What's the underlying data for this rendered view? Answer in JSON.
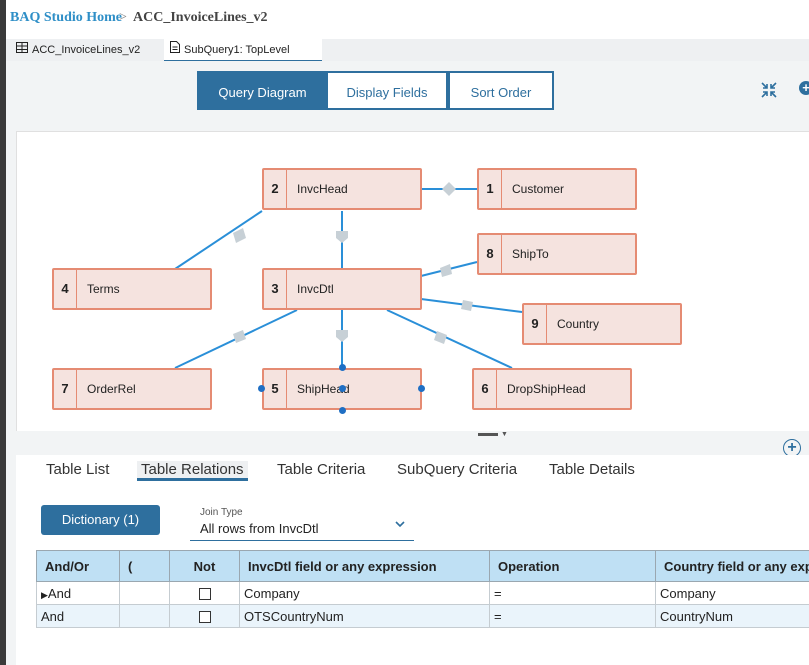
{
  "breadcrumb": {
    "home": "BAQ Studio Home",
    "separator": ">",
    "current": "ACC_InvoiceLines_v2"
  },
  "doc_tabs": [
    {
      "label": "ACC_InvoiceLines_v2",
      "icon": "table-icon",
      "active": false
    },
    {
      "label": "SubQuery1: TopLevel",
      "icon": "document-icon",
      "active": true
    }
  ],
  "view_tabs": [
    {
      "label": "Query Diagram",
      "active": true
    },
    {
      "label": "Display Fields",
      "active": false
    },
    {
      "label": "Sort Order",
      "active": false
    }
  ],
  "toolbar": {
    "collapse_icon": "collapse-arrows-icon",
    "add_icon": "add-circle-icon"
  },
  "diagram": {
    "tables": [
      {
        "id": "2",
        "name": "InvcHead"
      },
      {
        "id": "1",
        "name": "Customer"
      },
      {
        "id": "8",
        "name": "ShipTo"
      },
      {
        "id": "4",
        "name": "Terms"
      },
      {
        "id": "3",
        "name": "InvcDtl"
      },
      {
        "id": "9",
        "name": "Country"
      },
      {
        "id": "7",
        "name": "OrderRel"
      },
      {
        "id": "5",
        "name": "ShipHead"
      },
      {
        "id": "6",
        "name": "DropShipHead"
      }
    ],
    "line_color": "#2a8fd8",
    "node_fill": "#f5e3df",
    "node_border": "#e58b73"
  },
  "lower_tabs": [
    {
      "label": "Table List",
      "active": false
    },
    {
      "label": "Table Relations",
      "active": true
    },
    {
      "label": "Table Criteria",
      "active": false
    },
    {
      "label": "SubQuery Criteria",
      "active": false
    },
    {
      "label": "Table Details",
      "active": false
    }
  ],
  "dictionary_button": "Dictionary (1)",
  "join_type": {
    "label": "Join Type",
    "value": "All rows from InvcDtl"
  },
  "relations_grid": {
    "headers": [
      "And/Or",
      "(",
      "Not",
      "InvcDtl field or any expression",
      "Operation",
      "Country field or any expr"
    ],
    "rows": [
      {
        "and_or": "And",
        "paren": "",
        "not": false,
        "left": "Company",
        "op": "=",
        "right": "Company",
        "current": true
      },
      {
        "and_or": "And",
        "paren": "",
        "not": false,
        "left": "OTSCountryNum",
        "op": "=",
        "right": "CountryNum",
        "current": false
      }
    ]
  },
  "colors": {
    "accent": "#2e6f9e",
    "header_blue": "#bfe0f4",
    "link_blue": "#2f8fc7"
  }
}
